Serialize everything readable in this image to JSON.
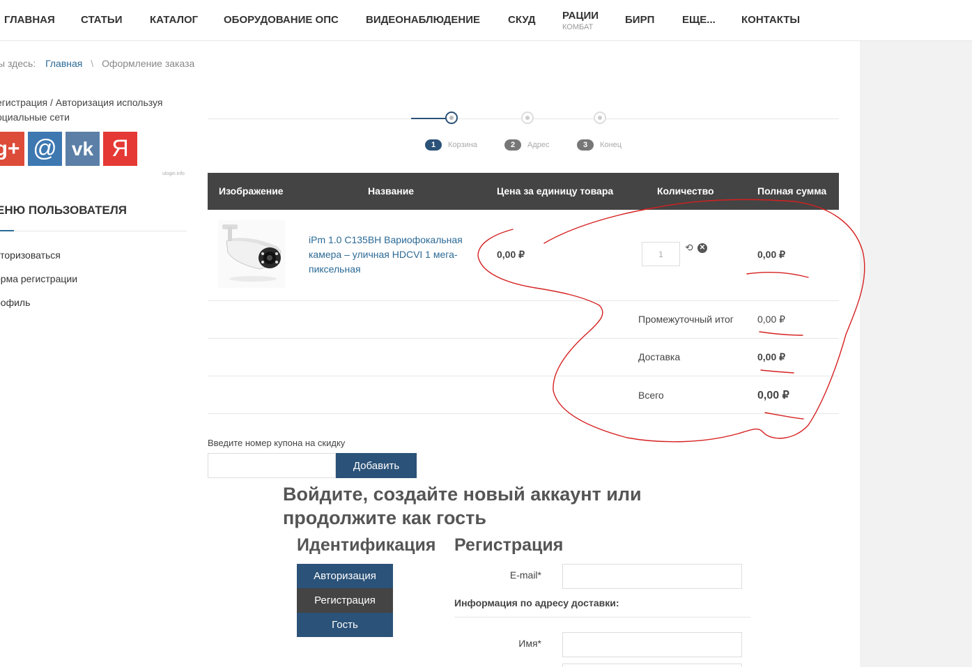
{
  "nav": [
    {
      "label": "ГЛАВНАЯ"
    },
    {
      "label": "СТАТЬИ"
    },
    {
      "label": "КАТАЛОГ"
    },
    {
      "label": "ОБОРУДОВАНИЕ ОПС"
    },
    {
      "label": "ВИДЕОНАБЛЮДЕНИЕ"
    },
    {
      "label": "СКУД"
    },
    {
      "label": "РАЦИИ",
      "sub": "КОМБАТ"
    },
    {
      "label": "БИРП"
    },
    {
      "label": "ЕЩЕ..."
    },
    {
      "label": "КОНТАКТЫ"
    }
  ],
  "breadcrumb": {
    "prefix": "ы здесь:",
    "home": "Главная",
    "sep": "\\",
    "current": "Оформление заказа"
  },
  "sidebar": {
    "social_text": "егистрация / Авторизация используя оциальные сети",
    "social": [
      {
        "name": "google-plus-icon",
        "glyph": "g+",
        "color": "#dd4b39"
      },
      {
        "name": "mail-icon",
        "glyph": "@",
        "color": "#3d78b1"
      },
      {
        "name": "vk-icon",
        "glyph": "vk",
        "color": "#5b7fa6"
      },
      {
        "name": "yandex-icon",
        "glyph": "Я",
        "color": "#e53935"
      }
    ],
    "ulogin": "ulogin.info",
    "menu_title": "ЕНЮ ПОЛЬЗОВАТЕЛЯ",
    "menu_items": [
      "вторизоваться",
      "орма регистрации",
      "рофиль"
    ]
  },
  "steps": [
    {
      "num": "1",
      "label": "Корзина",
      "active": true
    },
    {
      "num": "2",
      "label": "Адрес",
      "active": false
    },
    {
      "num": "3",
      "label": "Конец",
      "active": false
    }
  ],
  "table": {
    "headers": {
      "image": "Изображение",
      "name": "Название",
      "price": "Цена за единицу товара",
      "qty": "Количество",
      "total": "Полная сумма"
    },
    "item": {
      "name": "iPm 1.0 C135BH Вариофокальная камера – уличная HDCVI 1 мега-пиксельная",
      "price": "0,00 ₽",
      "qty": "1",
      "total": "0,00 ₽"
    },
    "summary": [
      {
        "label": "Промежуточный итог",
        "value": "0,00 ₽"
      },
      {
        "label": "Доставка",
        "value": "0,00 ₽"
      },
      {
        "label": "Всего",
        "value": "0,00 ₽"
      }
    ]
  },
  "coupon": {
    "label": "Введите номер купона на скидку",
    "button": "Добавить"
  },
  "login": {
    "heading": "Войдите, создайте новый аккаунт или продолжите как гость",
    "ident_title": "Идентификация",
    "reg_title": "Регистрация",
    "buttons": [
      {
        "label": "Авторизация",
        "color": "#2b5278"
      },
      {
        "label": "Регистрация",
        "color": "#444444"
      },
      {
        "label": "Гость",
        "color": "#2b5278"
      }
    ],
    "email_label": "E-mail*",
    "address_title": "Информация по адресу доставки:",
    "name_label": "Имя*"
  },
  "colors": {
    "accent": "#2b5278",
    "header_bg": "#444444",
    "link": "#2b6a96",
    "annotation": "#d62020"
  }
}
